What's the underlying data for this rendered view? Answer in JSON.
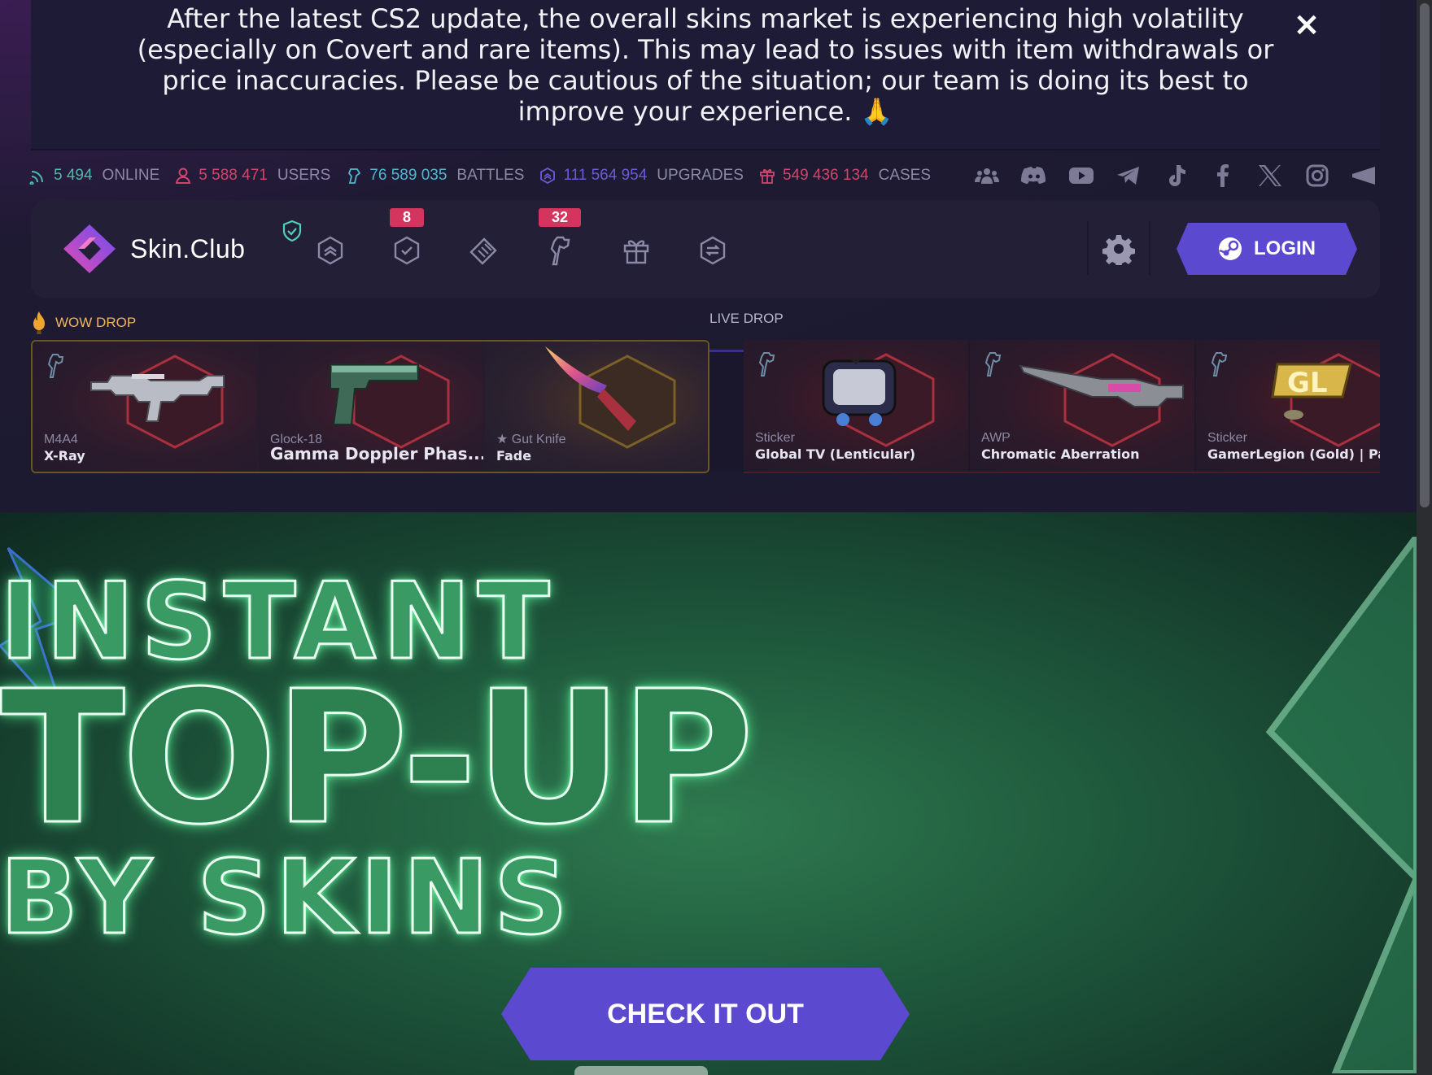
{
  "notice": {
    "text": "After the latest CS2 update, the overall skins market is experiencing high volatility (especially on Covert and rare items). This may lead to issues with item withdrawals or price inaccuracies. Please be cautious of the situation; our team is doing its best to improve your experience. 🙏",
    "close_icon": "×"
  },
  "stats": [
    {
      "icon": "signal-icon",
      "value": "5 494",
      "label": "ONLINE",
      "color": "#4fb8a9"
    },
    {
      "icon": "user-icon",
      "value": "5 588 471",
      "label": "USERS",
      "color": "#d1456d"
    },
    {
      "icon": "fist-icon",
      "value": "76 589 035",
      "label": "BATTLES",
      "color": "#4fb8d1"
    },
    {
      "icon": "upgrade-icon",
      "value": "111 564 954",
      "label": "UPGRADES",
      "color": "#6a5bd8"
    },
    {
      "icon": "box-icon",
      "value": "549 436 134",
      "label": "CASES",
      "color": "#d1456d"
    }
  ],
  "socials": [
    "community-icon",
    "discord-icon",
    "youtube-icon",
    "telegram-icon",
    "tiktok-icon",
    "facebook-icon",
    "x-icon",
    "instagram-icon",
    "megaphone-icon"
  ],
  "header": {
    "logo_text": "Skin.Club",
    "nav": [
      {
        "icon": "upgrade-nav-icon",
        "badge": ""
      },
      {
        "icon": "check-shield-icon",
        "badge": "8"
      },
      {
        "icon": "tickets-icon",
        "badge": ""
      },
      {
        "icon": "battles-fist-icon",
        "badge": "32"
      },
      {
        "icon": "gift-box-icon",
        "badge": ""
      },
      {
        "icon": "exchange-icon",
        "badge": ""
      }
    ],
    "login_label": "LOGIN"
  },
  "wow_drop": {
    "label": "WOW DROP",
    "items": [
      {
        "type": "M4A4",
        "name": "X-Ray"
      },
      {
        "type": "Glock-18",
        "name": "Gamma Doppler Phas..."
      },
      {
        "type": "★ Gut Knife",
        "name": "Fade"
      }
    ]
  },
  "live_drop": {
    "label": "LIVE DROP",
    "items": [
      {
        "type": "Sticker",
        "name": "Global TV (Lenticular)"
      },
      {
        "type": "AWP",
        "name": "Chromatic Aberration"
      },
      {
        "type": "Sticker",
        "name": "GamerLegion (Gold) | Pari"
      }
    ]
  },
  "banner": {
    "line1": "INSTANT",
    "line2": "TOP-UP",
    "line3": "BY SKINS",
    "cta_label": "CHECK IT OUT"
  }
}
